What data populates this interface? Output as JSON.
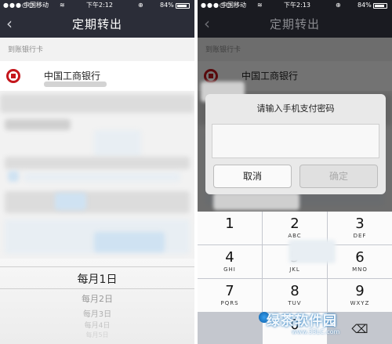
{
  "status_left": {
    "signal": "●●●○○",
    "carrier": "中国移动",
    "wifi": "≋",
    "time": "下午2:12",
    "lock": "⊕",
    "battery": "84%"
  },
  "status_right": {
    "signal": "●●●○○",
    "carrier": "中国移动",
    "wifi": "≋",
    "time": "下午2:13",
    "lock": "⊕",
    "battery": "84%"
  },
  "battery_level": 0.84,
  "nav": {
    "title": "定期转出",
    "back_icon": "chevron-left-icon",
    "back_glyph": "‹"
  },
  "section_label": "到账银行卡",
  "bank": {
    "name": "中国工商银行",
    "logo_color": "#c4161c"
  },
  "picker": {
    "items": [
      "每月1日",
      "每月2日",
      "每月3日",
      "每月4日",
      "每月5日"
    ],
    "selected": "每月1日"
  },
  "dialog": {
    "title": "请输入手机支付密码",
    "input_value": "",
    "cancel": "取消",
    "confirm": "确定"
  },
  "keypad": {
    "keys": [
      {
        "num": "1",
        "sub": ""
      },
      {
        "num": "2",
        "sub": "ABC"
      },
      {
        "num": "3",
        "sub": "DEF"
      },
      {
        "num": "4",
        "sub": "GHI"
      },
      {
        "num": "5",
        "sub": "JKL"
      },
      {
        "num": "6",
        "sub": "MNO"
      },
      {
        "num": "7",
        "sub": "PQRS"
      },
      {
        "num": "8",
        "sub": "TUV"
      },
      {
        "num": "9",
        "sub": "WXYZ"
      },
      {
        "num": "0",
        "sub": ""
      }
    ],
    "delete_glyph": "⌫"
  },
  "watermark": {
    "text": "绿茶软件园",
    "url": "www.33LC.com"
  },
  "colors": {
    "nav_bg": "#2b2d38",
    "accent_red": "#c4161c",
    "keypad_bg": "#c4c7ce"
  }
}
